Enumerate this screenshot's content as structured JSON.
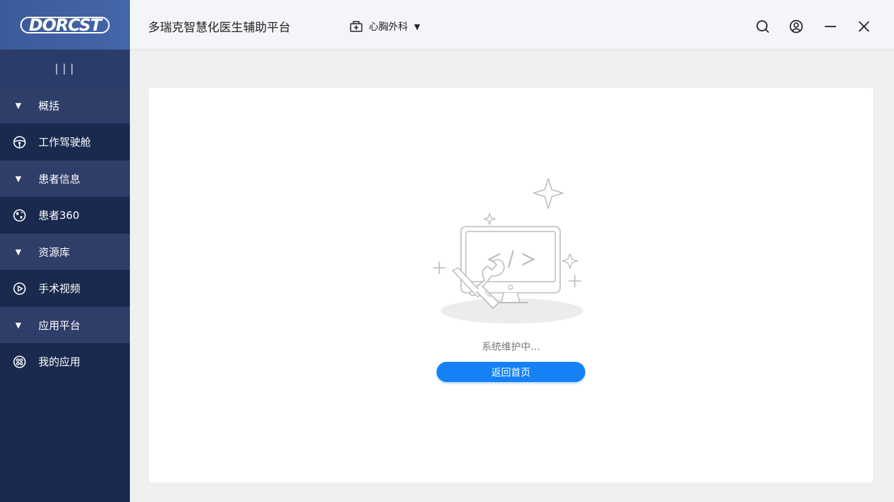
{
  "app": {
    "logo_text": "DORCST",
    "title": "多瑞克智慧化医生辅助平台"
  },
  "header": {
    "department": "心胸外科",
    "icons": [
      "search-icon",
      "user-icon",
      "minimize-icon",
      "close-icon"
    ]
  },
  "sidebar": {
    "toggle_label": "|||",
    "groups": [
      {
        "label": "概括",
        "item": "工作驾驶舱",
        "item_icon": "steering-wheel-icon"
      },
      {
        "label": "患者信息",
        "item": "患者360",
        "item_icon": "globe-icon"
      },
      {
        "label": "资源库",
        "item": "手术视频",
        "item_icon": "play-icon"
      },
      {
        "label": "应用平台",
        "item": "我的应用",
        "item_icon": "apps-icon"
      }
    ]
  },
  "main": {
    "status_text": "系统维护中...",
    "back_button": "返回首页"
  },
  "colors": {
    "sidebar_bg": "#1a2a4f",
    "group_bg": "#2f3d69",
    "accent": "#1481f5"
  }
}
